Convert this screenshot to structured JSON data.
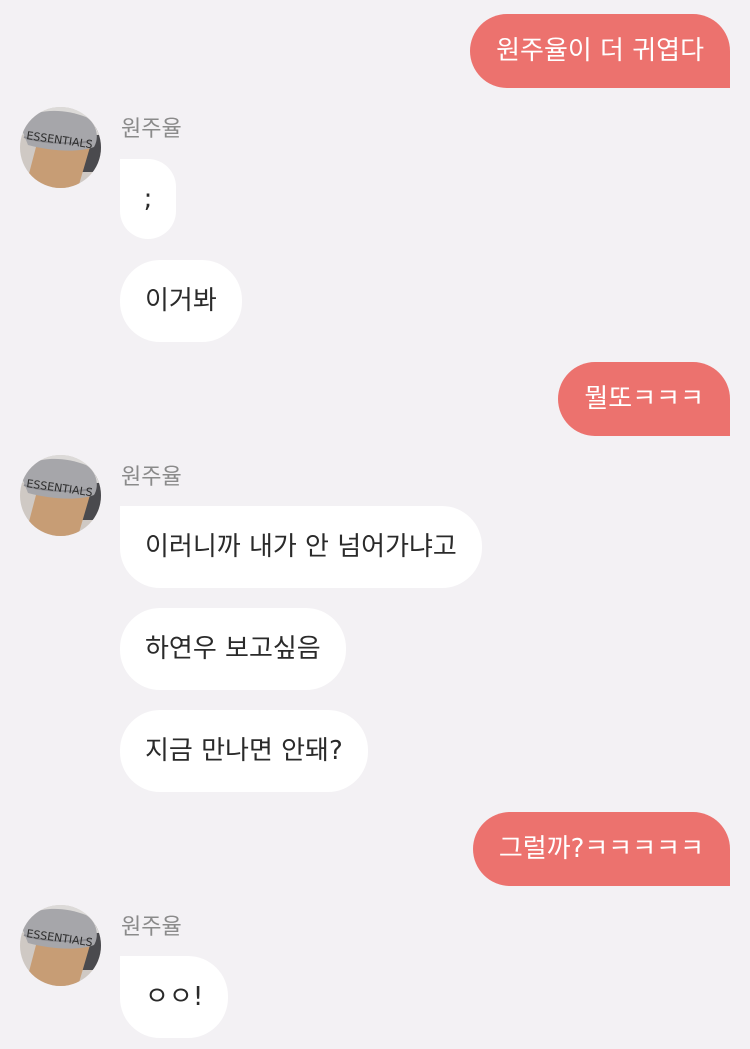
{
  "sender_name": "원주율",
  "messages": [
    {
      "from": "me",
      "text": "원주율이 더 귀엽다"
    },
    {
      "from": "other",
      "text": ";"
    },
    {
      "from": "other",
      "text": "이거봐"
    },
    {
      "from": "me",
      "text": "뭘또ㅋㅋㅋ"
    },
    {
      "from": "other",
      "text": "이러니까 내가 안 넘어가냐고"
    },
    {
      "from": "other",
      "text": "하연우 보고싶음"
    },
    {
      "from": "other",
      "text": "지금 만나면 안돼?"
    },
    {
      "from": "me",
      "text": "그럴까?ㅋㅋㅋㅋㅋ"
    },
    {
      "from": "other",
      "text": "ㅇㅇ!"
    }
  ],
  "avatar_shirt_text": "ESSENTIALS",
  "colors": {
    "background": "#f3f1f4",
    "outgoing_bubble": "#ec726e",
    "incoming_bubble": "#ffffff",
    "sender_name": "#8a8a8a"
  }
}
